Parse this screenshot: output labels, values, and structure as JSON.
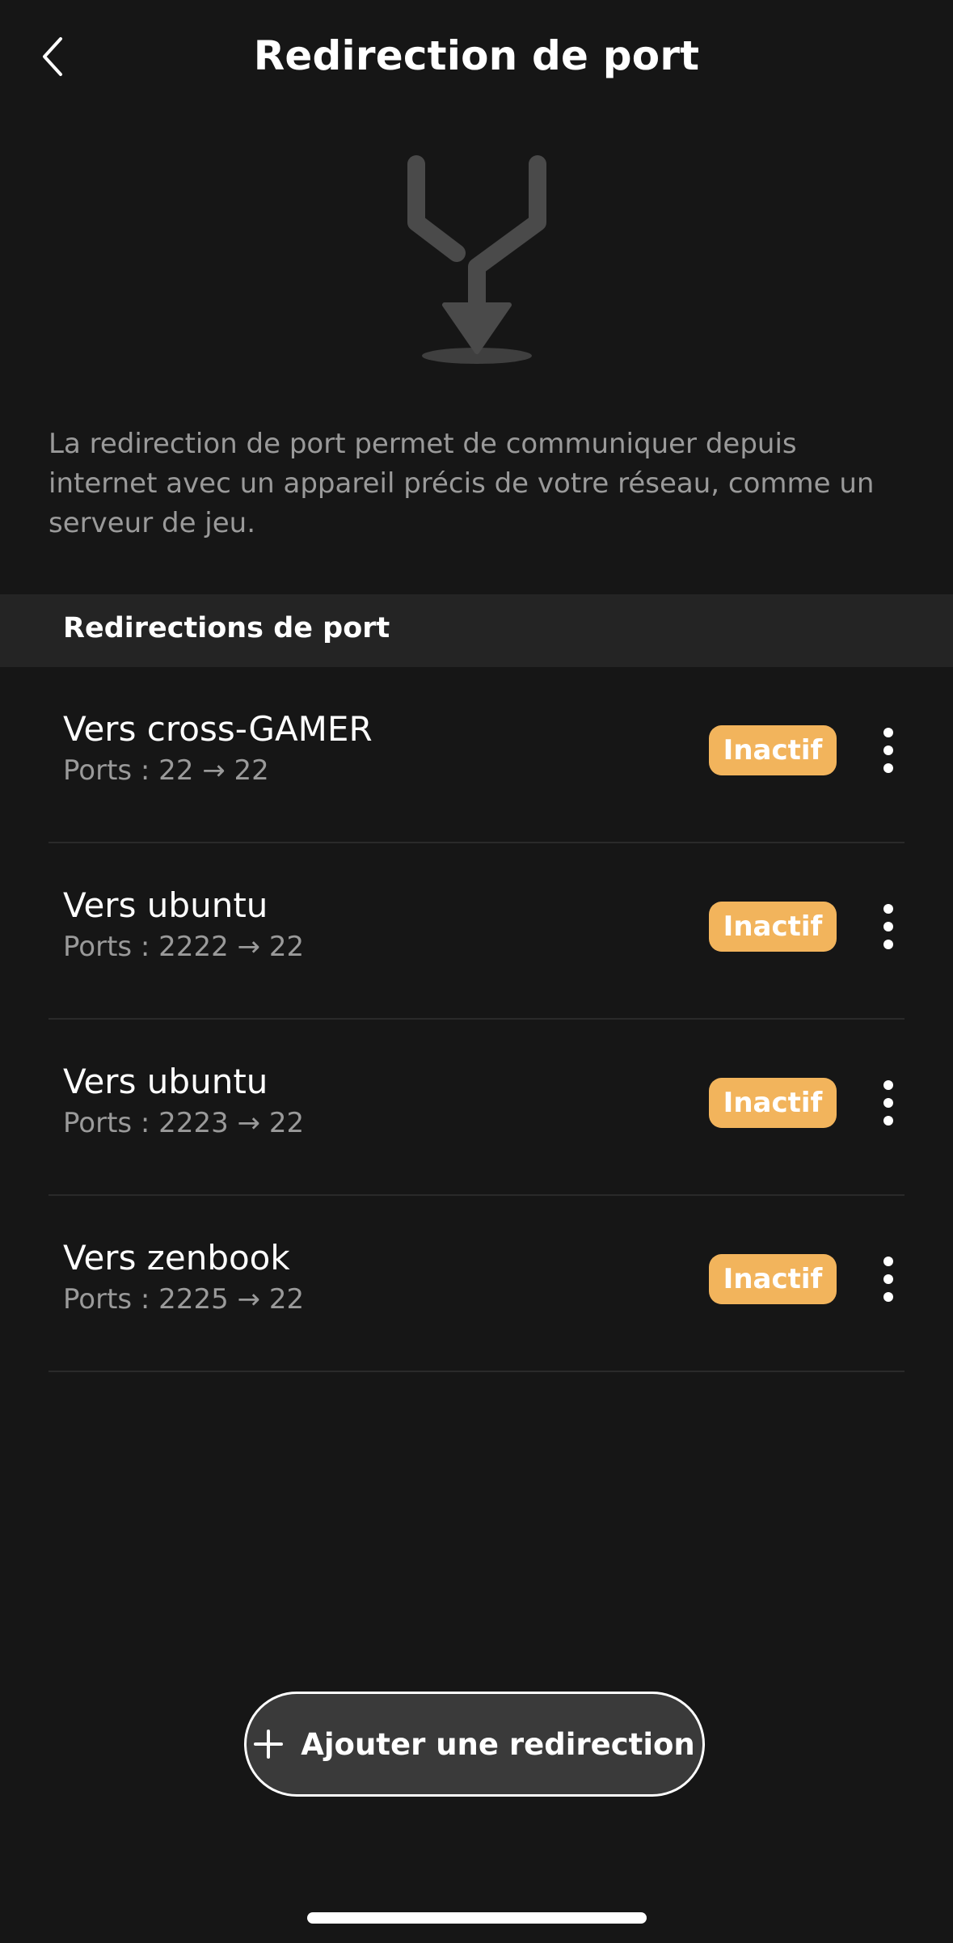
{
  "header": {
    "title": "Redirection de port",
    "back_icon": "chevron-left-icon"
  },
  "hero": {
    "icon": "port-forward-merge-icon",
    "description": "La redirection de port permet de communiquer depuis internet avec un appareil précis de votre réseau, comme un serveur de jeu."
  },
  "section": {
    "title": "Redirections de port"
  },
  "redirections": [
    {
      "title": "Vers cross-GAMER",
      "ports": "Ports : 22 → 22",
      "status": "Inactif"
    },
    {
      "title": "Vers ubuntu",
      "ports": "Ports : 2222 → 22",
      "status": "Inactif"
    },
    {
      "title": "Vers ubuntu",
      "ports": "Ports : 2223 → 22",
      "status": "Inactif"
    },
    {
      "title": "Vers zenbook",
      "ports": "Ports : 2225 → 22",
      "status": "Inactif"
    }
  ],
  "add_button": {
    "label": "Ajouter une redirection",
    "icon": "plus-icon"
  },
  "colors": {
    "background": "#161616",
    "section_background": "#242424",
    "status_inactive": "#f2b45c",
    "secondary_text": "#9a9a9a",
    "illustration": "#4a4a4a"
  }
}
